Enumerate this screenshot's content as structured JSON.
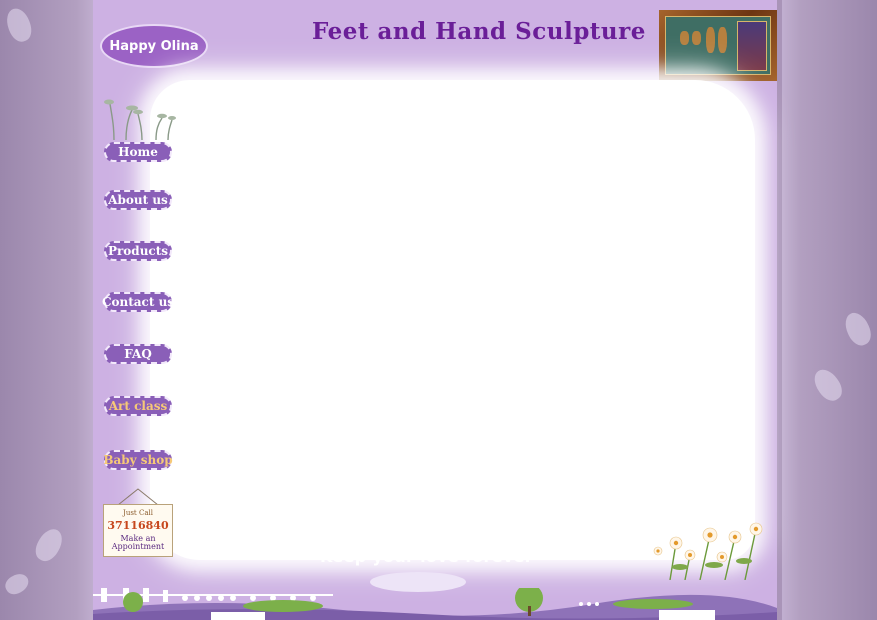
{
  "brand": {
    "logo_text": "Happy Olina",
    "site_title": "Feet and Hand Sculpture",
    "tagline": "Keep your love forever"
  },
  "nav": {
    "items": [
      {
        "label": "Home"
      },
      {
        "label": "About us"
      },
      {
        "label": "Products"
      },
      {
        "label": "Contact us"
      },
      {
        "label": "FAQ"
      },
      {
        "label": "Art class"
      },
      {
        "label": "Baby shop"
      }
    ]
  },
  "sign": {
    "line1": "Just Call",
    "phone": "37116840",
    "line3": "Make an Appointment"
  },
  "colors": {
    "page_background": "#cdb1e3",
    "title": "#6a1e98",
    "button": "#8a5fb8",
    "alt_button_text": "#f6c977"
  },
  "icons": [
    "footprint-icon",
    "sprout-icon",
    "flower-icon",
    "fence-icon",
    "tree-icon"
  ]
}
